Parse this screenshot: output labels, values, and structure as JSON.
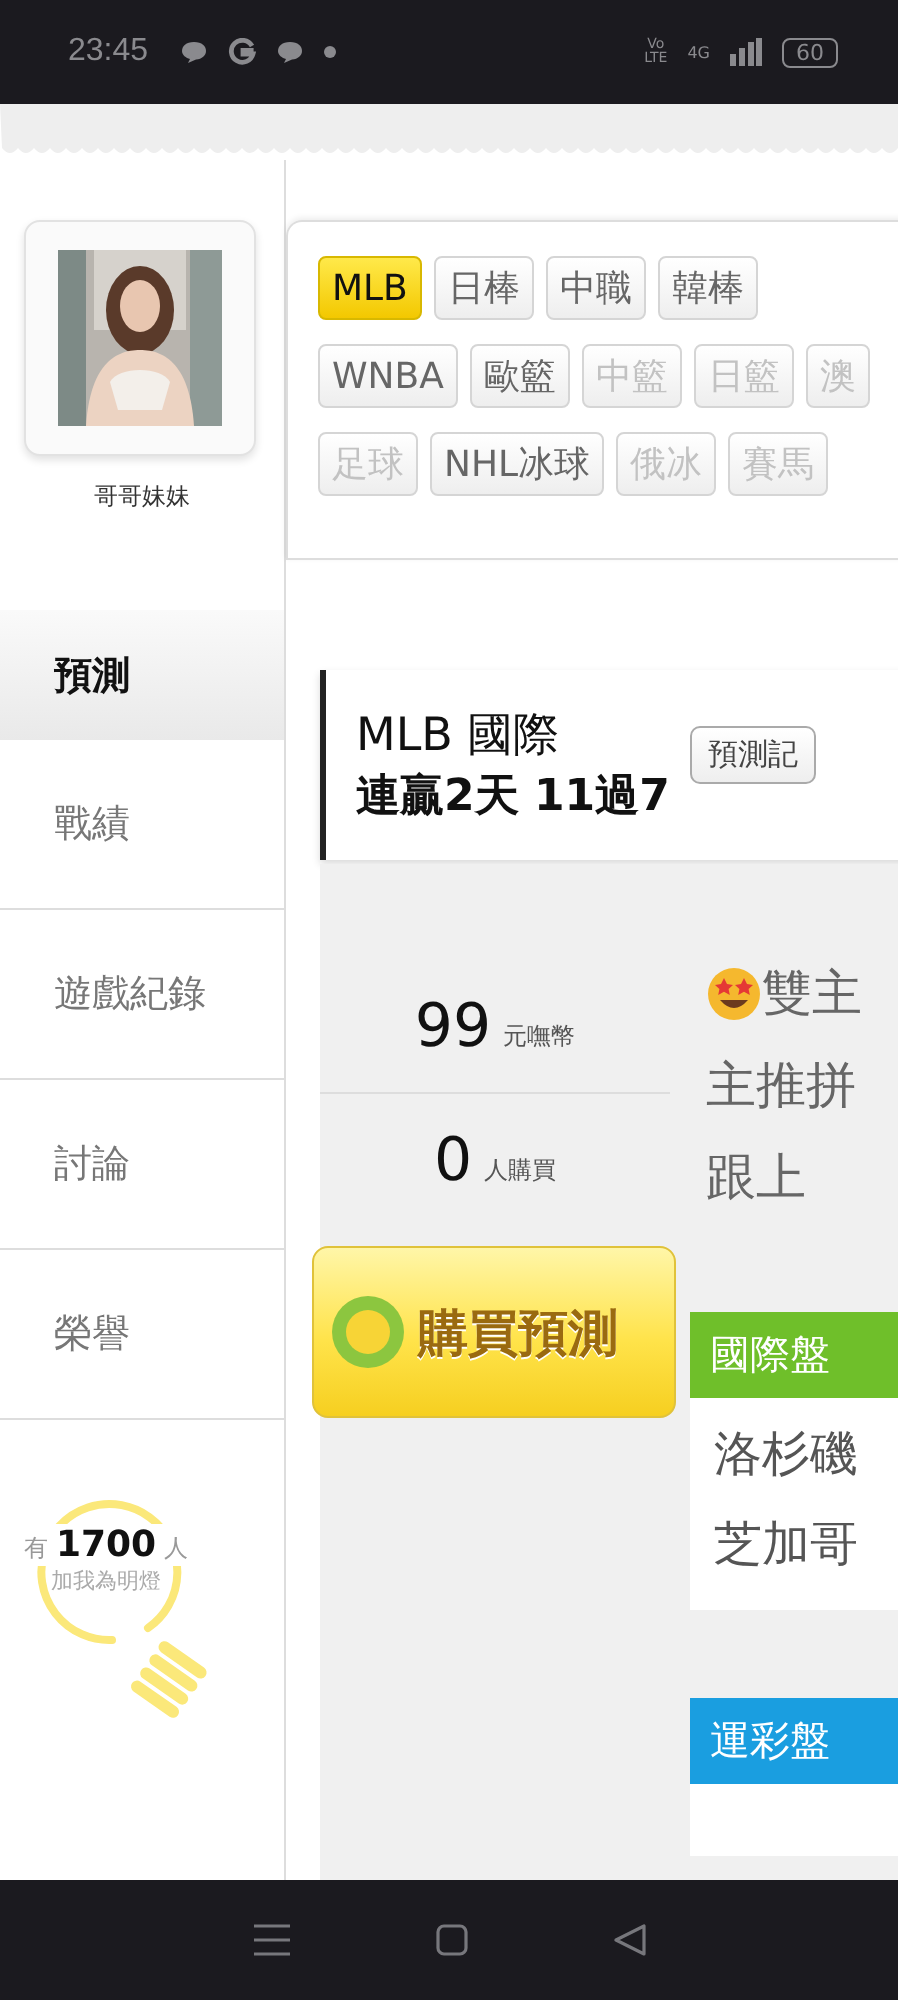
{
  "status_bar": {
    "time": "23:45",
    "volte_top": "Vo",
    "volte_bottom": "LTE",
    "network": "4G",
    "battery": "60"
  },
  "profile": {
    "name": "哥哥妹妹"
  },
  "sidebar": {
    "items": [
      {
        "label": "預測",
        "selected": true
      },
      {
        "label": "戰績",
        "selected": false
      },
      {
        "label": "遊戲紀錄",
        "selected": false
      },
      {
        "label": "討論",
        "selected": false
      },
      {
        "label": "榮譽",
        "selected": false
      }
    ]
  },
  "fans": {
    "text": "有 **1700** 人",
    "subtitle": "加我為明燈"
  },
  "tag_rows": [
    [
      {
        "label": "MLB",
        "selected": true,
        "disabled": false
      },
      {
        "label": "日棒",
        "selected": false,
        "disabled": false
      },
      {
        "label": "中職",
        "selected": false,
        "disabled": false
      },
      {
        "label": "韓棒",
        "selected": false,
        "disabled": false
      }
    ],
    [
      {
        "label": "WNBA",
        "selected": false,
        "disabled": false
      },
      {
        "label": "歐籃",
        "selected": false,
        "disabled": false
      },
      {
        "label": "中籃",
        "selected": false,
        "disabled": true
      },
      {
        "label": "日籃",
        "selected": false,
        "disabled": true
      },
      {
        "label": "澳",
        "selected": false,
        "disabled": true
      }
    ],
    [
      {
        "label": "足球",
        "selected": false,
        "disabled": true
      },
      {
        "label": "NHL冰球",
        "selected": false,
        "disabled": false
      },
      {
        "label": "俄冰",
        "selected": false,
        "disabled": true
      },
      {
        "label": "賽馬",
        "selected": false,
        "disabled": true
      }
    ]
  ],
  "prediction": {
    "league": "MLB 國際",
    "streak": "連贏2天 11過7",
    "record_button": "預測記",
    "price": "99",
    "price_unit": "元嘸幣",
    "buyers": "0",
    "buyers_unit": "人購買",
    "buy_button": "購買預測",
    "description_lines": [
      "雙主",
      "主推拼",
      "跟上"
    ],
    "sections": [
      {
        "title": "國際盤",
        "color": "#6fbf2a",
        "lines": [
          "洛杉磯",
          "芝加哥"
        ]
      },
      {
        "title": "運彩盤",
        "color": "#1a9ee0"
      }
    ]
  }
}
